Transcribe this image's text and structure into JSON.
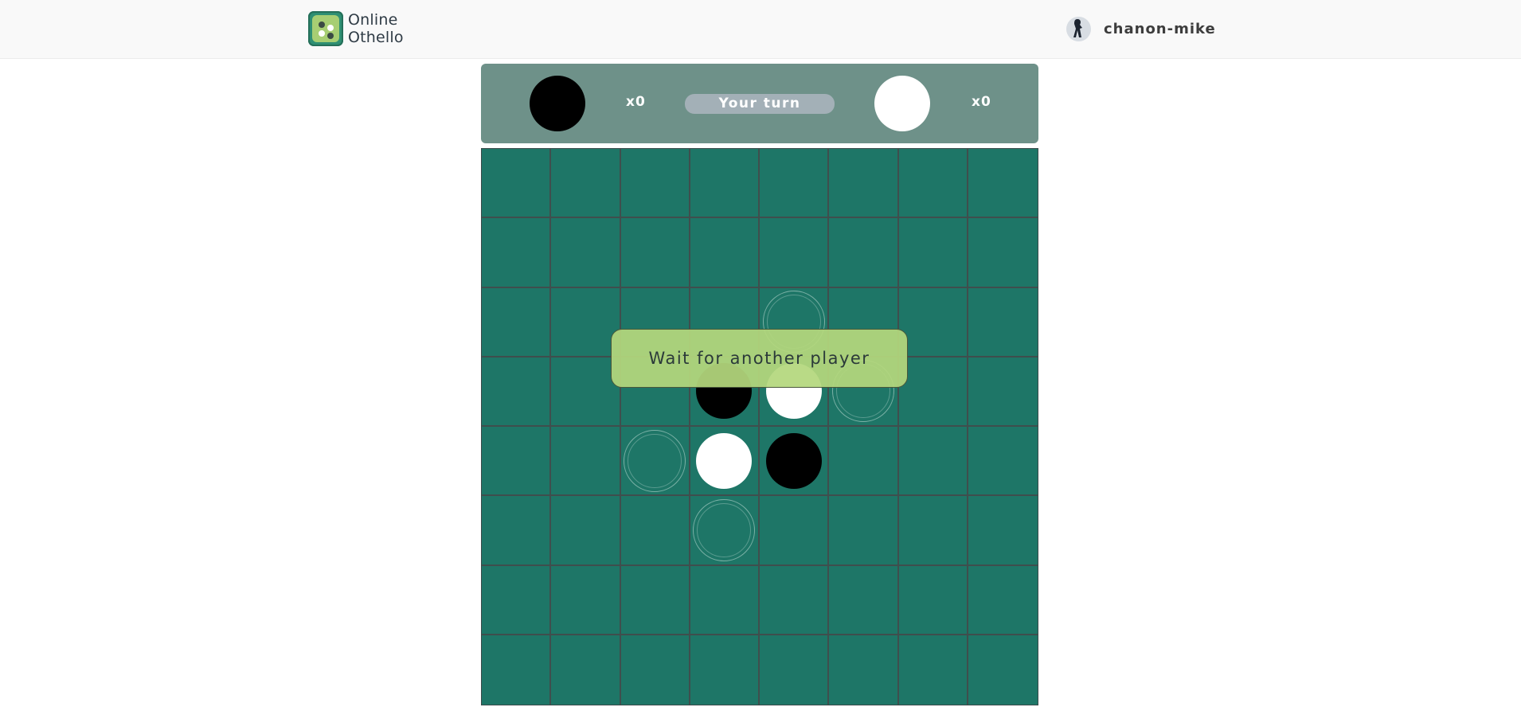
{
  "header": {
    "logo_line1": "Online",
    "logo_line2": "Othello",
    "username": "chanon-mike",
    "logo_icon": "dice-icon",
    "avatar_icon": "user-avatar-icon"
  },
  "score": {
    "black_count": "x0",
    "white_count": "x0",
    "turn_label": "Your turn"
  },
  "overlay": {
    "message": "Wait for another player"
  },
  "board": {
    "rows": [
      [
        "",
        "",
        "",
        "",
        "",
        "",
        "",
        ""
      ],
      [
        "",
        "",
        "",
        "",
        "",
        "",
        "",
        ""
      ],
      [
        "",
        "",
        "",
        "",
        "hint",
        "",
        "",
        ""
      ],
      [
        "",
        "",
        "",
        "black",
        "white",
        "hint",
        "",
        ""
      ],
      [
        "",
        "",
        "hint",
        "white",
        "black",
        "",
        "",
        ""
      ],
      [
        "",
        "",
        "",
        "hint",
        "",
        "",
        "",
        ""
      ],
      [
        "",
        "",
        "",
        "",
        "",
        "",
        "",
        ""
      ],
      [
        "",
        "",
        "",
        "",
        "",
        "",
        "",
        ""
      ]
    ]
  },
  "colors": {
    "board": "#1e7667",
    "scorebar": "#6e9189",
    "overlay": "#b4d77d",
    "turn_pill": "#a3b0b7"
  }
}
